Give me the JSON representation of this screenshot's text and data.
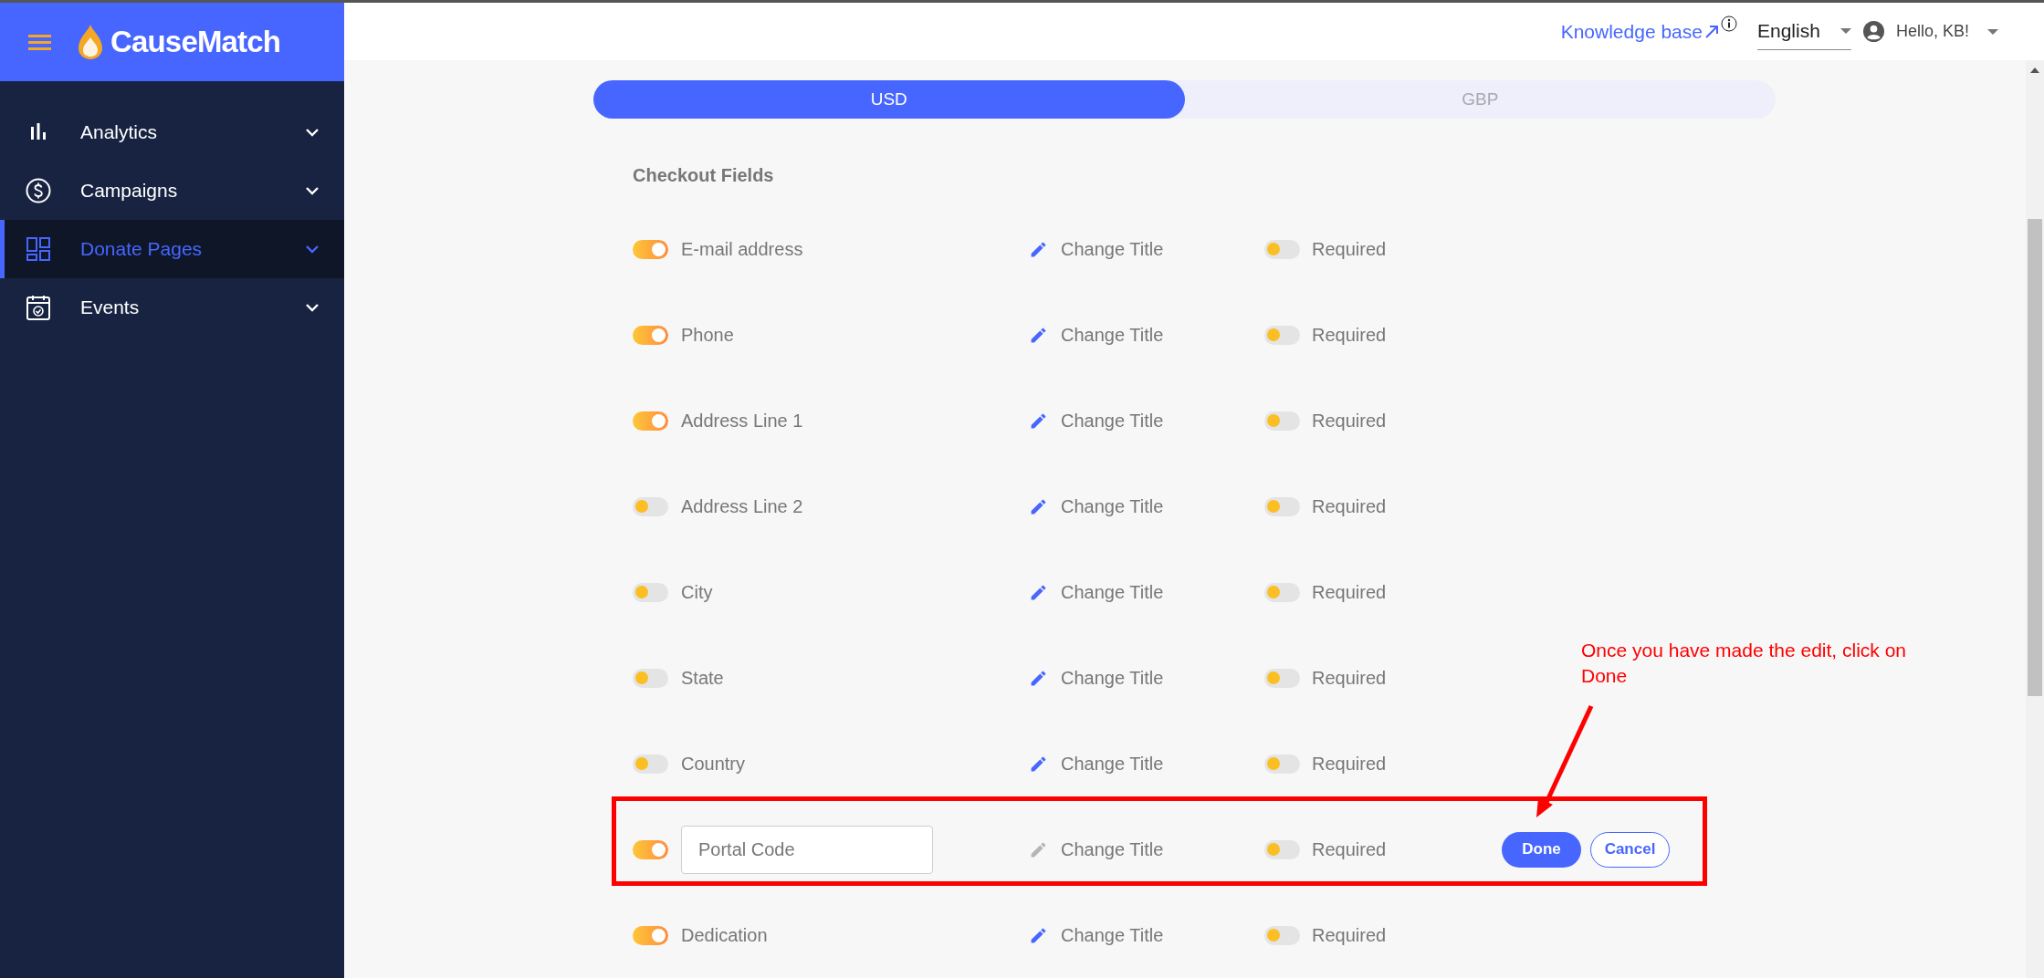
{
  "brand": {
    "name": "CauseMatch"
  },
  "sidebar": {
    "items": [
      {
        "label": "Analytics",
        "selected": false
      },
      {
        "label": "Campaigns",
        "selected": false
      },
      {
        "label": "Donate Pages",
        "selected": true
      },
      {
        "label": "Events",
        "selected": false
      }
    ]
  },
  "header": {
    "knowledge_base": "Knowledge base",
    "language": "English",
    "greeting": "Hello, KB!"
  },
  "currency_tabs": [
    {
      "label": "USD",
      "selected": true
    },
    {
      "label": "GBP",
      "selected": false
    }
  ],
  "section_title": "Checkout Fields",
  "fields": [
    {
      "label": "E-mail address",
      "enabled": true,
      "editing": false,
      "change_title": "Change Title",
      "required_label": "Required",
      "required": false
    },
    {
      "label": "Phone",
      "enabled": true,
      "editing": false,
      "change_title": "Change Title",
      "required_label": "Required",
      "required": false
    },
    {
      "label": "Address Line 1",
      "enabled": true,
      "editing": false,
      "change_title": "Change Title",
      "required_label": "Required",
      "required": false
    },
    {
      "label": "Address Line 2",
      "enabled": false,
      "editing": false,
      "change_title": "Change Title",
      "required_label": "Required",
      "required": false
    },
    {
      "label": "City",
      "enabled": false,
      "editing": false,
      "change_title": "Change Title",
      "required_label": "Required",
      "required": false
    },
    {
      "label": "State",
      "enabled": false,
      "editing": false,
      "change_title": "Change Title",
      "required_label": "Required",
      "required": false
    },
    {
      "label": "Country",
      "enabled": false,
      "editing": false,
      "change_title": "Change Title",
      "required_label": "Required",
      "required": false
    },
    {
      "label": "Portal Code",
      "enabled": true,
      "editing": true,
      "change_title": "Change Title",
      "required_label": "Required",
      "required": false,
      "done": "Done",
      "cancel": "Cancel"
    },
    {
      "label": "Dedication",
      "enabled": true,
      "editing": false,
      "change_title": "Change Title",
      "required_label": "Required",
      "required": false
    }
  ],
  "annotation": {
    "text": "Once you have made the edit, click on Done"
  }
}
